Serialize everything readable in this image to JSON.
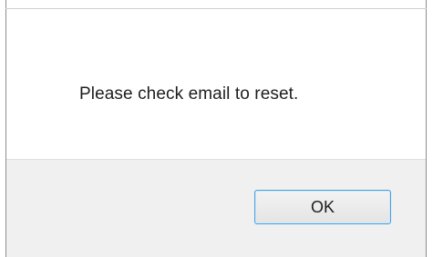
{
  "dialog": {
    "message": "Please check email to reset.",
    "ok_label": "OK"
  }
}
